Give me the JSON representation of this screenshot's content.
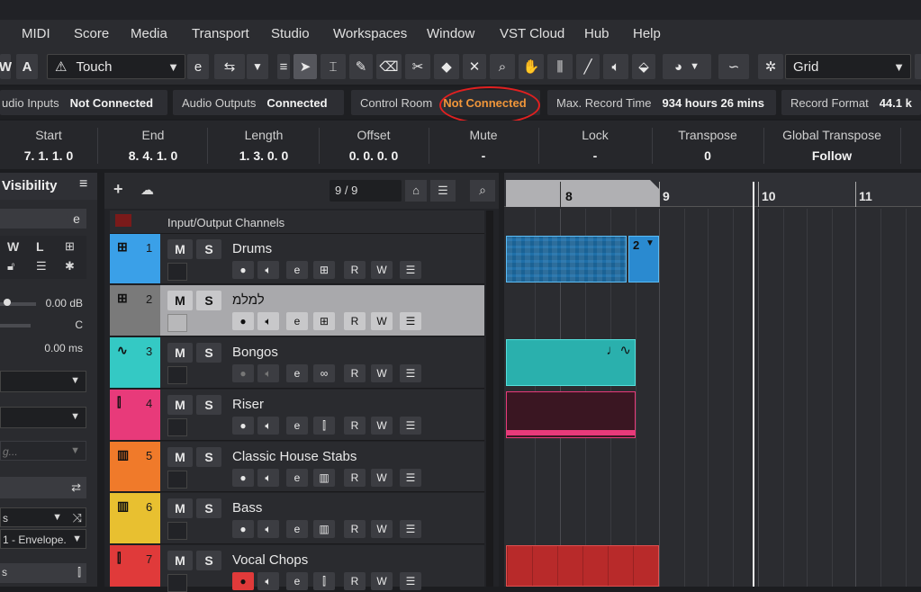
{
  "menu": [
    "MIDI",
    "Score",
    "Media",
    "Transport",
    "Studio",
    "Workspaces",
    "Window",
    "VST Cloud",
    "Hub",
    "Help"
  ],
  "toolbar": {
    "automation_mode": "Touch",
    "snap_type": "Grid",
    "btn_w": "W",
    "btn_a": "A"
  },
  "status": {
    "audio_inputs_label": "udio Inputs",
    "audio_inputs_value": "Not Connected",
    "audio_outputs_label": "Audio Outputs",
    "audio_outputs_value": "Connected",
    "control_room_label": "Control Room",
    "control_room_value": "Not Connected",
    "max_record_label": "Max. Record Time",
    "max_record_value": "934 hours 26 mins",
    "record_format_label": "Record Format",
    "record_format_value": "44.1 k",
    "colors": {
      "warning": "#f0963a",
      "highlight_circle": "#e02020"
    }
  },
  "infoline": [
    {
      "h": "Start",
      "v": "7. 1. 1.   0"
    },
    {
      "h": "End",
      "v": "8. 4. 1.   0"
    },
    {
      "h": "Length",
      "v": "1. 3. 0.   0"
    },
    {
      "h": "Offset",
      "v": "0. 0. 0.   0"
    },
    {
      "h": "Mute",
      "v": "-"
    },
    {
      "h": "Lock",
      "v": "-"
    },
    {
      "h": "Transpose",
      "v": "0"
    },
    {
      "h": "Global Transpose",
      "v": "Follow"
    }
  ],
  "inspector": {
    "title": "Visibility",
    "volume": "0.00 dB",
    "pan": "C",
    "delay": "0.00 ms",
    "placeholder": "g...",
    "envelope": "1 - Envelope.",
    "w": "W",
    "l": "L"
  },
  "tracklist": {
    "count": "9 / 9",
    "folder": "Input/Output Channels",
    "m": "M",
    "s": "S",
    "r": "R",
    "w": "W",
    "tracks": [
      {
        "num": "1",
        "name": "Drums",
        "color": "#3aa0e8"
      },
      {
        "num": "2",
        "name": "למלמ",
        "color": "#7a7a7a"
      },
      {
        "num": "3",
        "name": "Bongos",
        "color": "#34c9c4"
      },
      {
        "num": "4",
        "name": "Riser",
        "color": "#e83a7a"
      },
      {
        "num": "5",
        "name": "Classic House Stabs",
        "color": "#f07a2a"
      },
      {
        "num": "6",
        "name": "Bass",
        "color": "#e8c030"
      },
      {
        "num": "7",
        "name": "Vocal Chops",
        "color": "#e03a3a"
      }
    ]
  },
  "ruler": {
    "bars": [
      "8",
      "9",
      "10",
      "11"
    ]
  },
  "parts": {
    "drums_badge": "2"
  }
}
